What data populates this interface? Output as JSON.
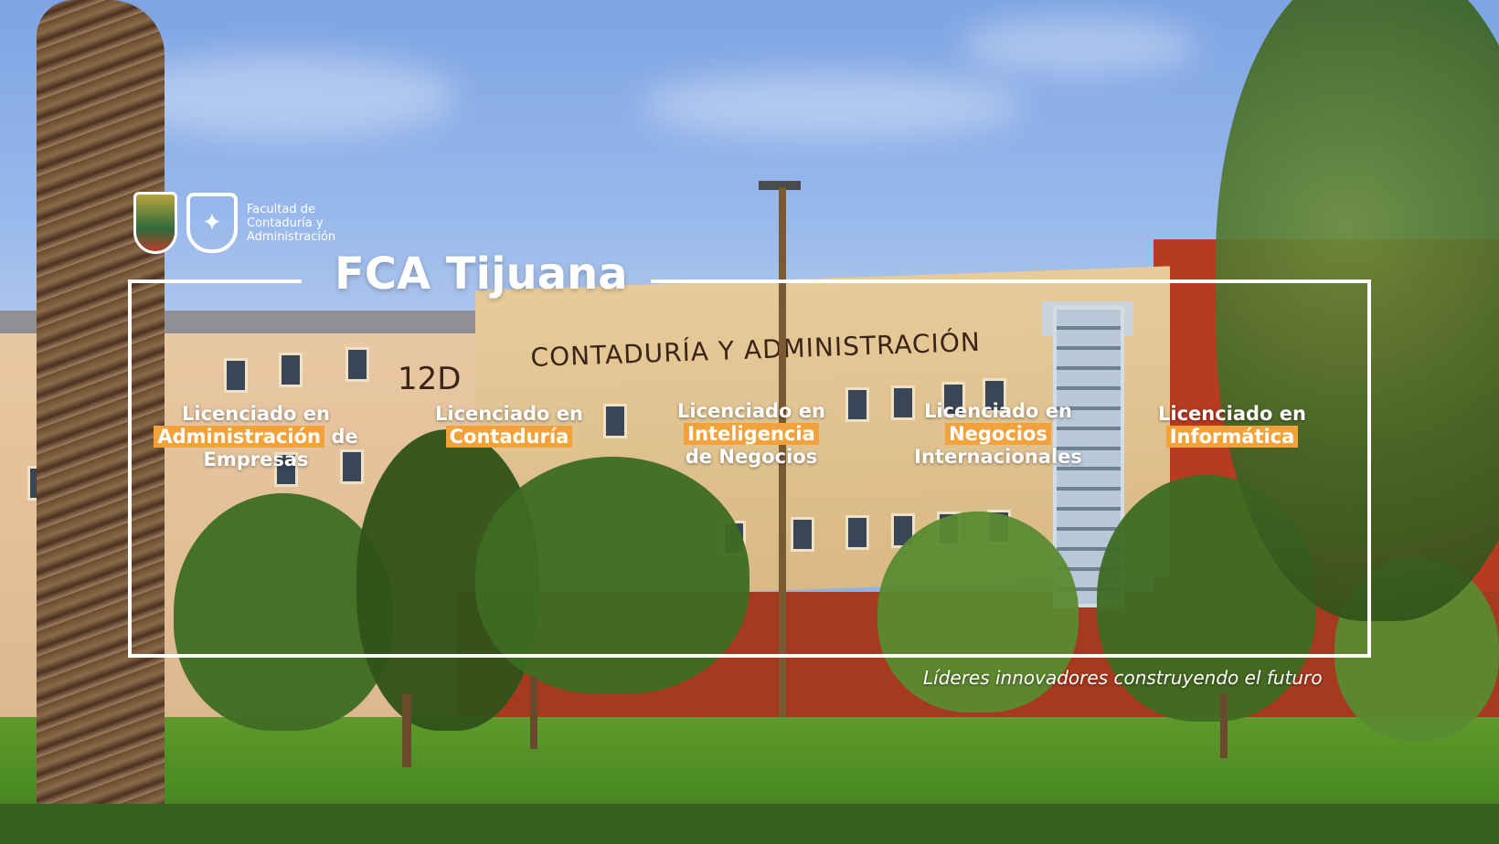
{
  "brand": {
    "title": "FCA Tijuana",
    "faculty_name": "Facultad de Contaduría y Administración",
    "university_logo_icon": "uabc-shield-icon",
    "faculty_logo_icon": "fca-logo-icon"
  },
  "building": {
    "sign": "CONTADURÍA Y ADMINISTRACIÓN",
    "number": "12D"
  },
  "degrees": [
    {
      "pre": "Licenciado en",
      "highlight": "Administración",
      "post": "de Empresas"
    },
    {
      "pre": "Licenciado en",
      "highlight": "Contaduría",
      "post": ""
    },
    {
      "pre": "Licenciado en",
      "highlight": "Inteligencia",
      "post": "de Negocios"
    },
    {
      "pre": "Licenciado en",
      "highlight": "Negocios",
      "post": "Internacionales"
    },
    {
      "pre": "Licenciado en",
      "highlight": "Informática",
      "post": ""
    }
  ],
  "tagline": "Líderes innovadores construyendo el futuro",
  "colors": {
    "highlight": "#f2a23a",
    "frame": "#ffffff",
    "text": "#ffffff"
  }
}
